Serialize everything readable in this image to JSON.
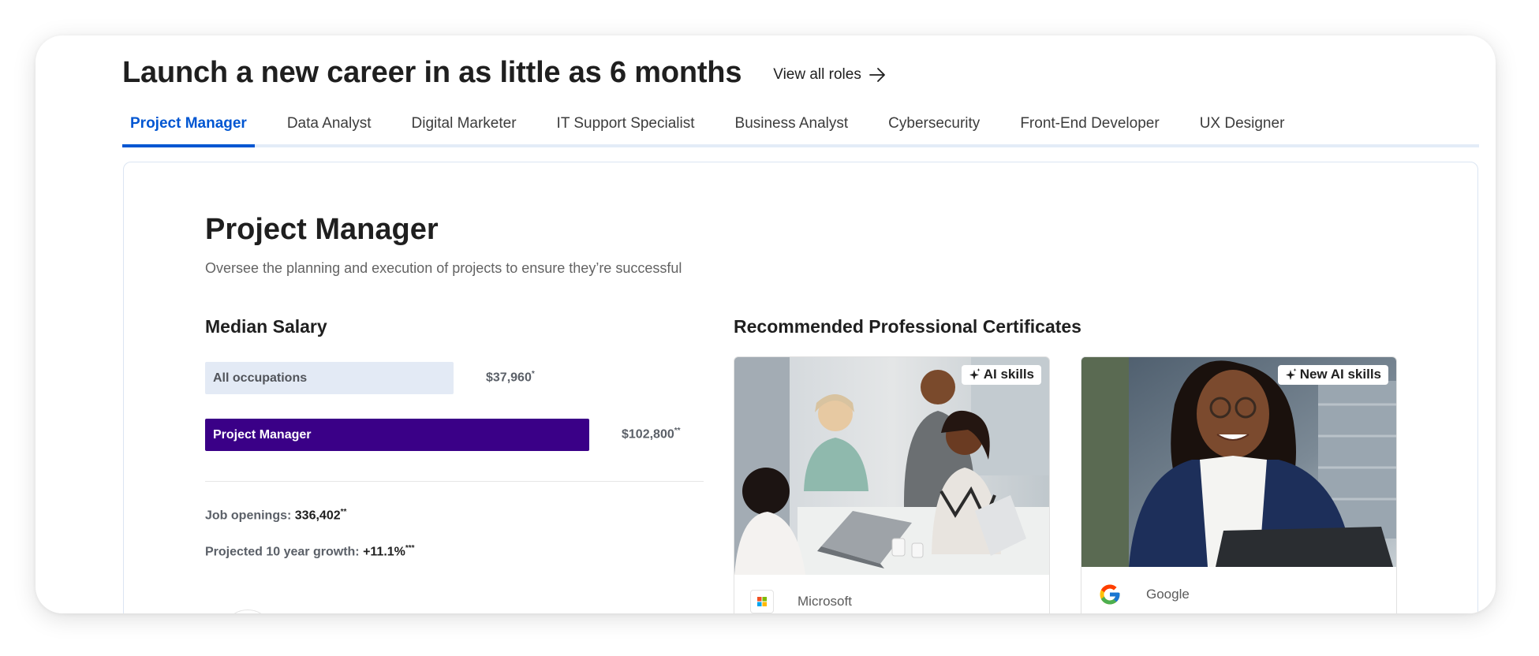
{
  "header": {
    "headline": "Launch a new career in as little as 6 months",
    "view_all_label": "View all roles"
  },
  "tabs": [
    {
      "label": "Project Manager",
      "active": true
    },
    {
      "label": "Data Analyst",
      "active": false
    },
    {
      "label": "Digital Marketer",
      "active": false
    },
    {
      "label": "IT Support Specialist",
      "active": false
    },
    {
      "label": "Business Analyst",
      "active": false
    },
    {
      "label": "Cybersecurity",
      "active": false
    },
    {
      "label": "Front-End Developer",
      "active": false
    },
    {
      "label": "UX Designer",
      "active": false
    }
  ],
  "role": {
    "title": "Project Manager",
    "description": "Oversee the planning and execution of projects to ensure they’re successful"
  },
  "salary": {
    "title": "Median Salary",
    "rows": [
      {
        "label": "All occupations",
        "value": "$37,960",
        "mark": "*",
        "amount": 37960
      },
      {
        "label": "Project Manager",
        "value": "$102,800",
        "mark": "**",
        "amount": 102800
      }
    ]
  },
  "stats": {
    "jobs_label": "Job openings: ",
    "jobs_value": "336,402",
    "jobs_mark": "**",
    "growth_label": "Projected 10 year growth: ",
    "growth_value": "+11.1%",
    "growth_mark": "***"
  },
  "certificates": {
    "title": "Recommended Professional Certificates",
    "cards": [
      {
        "badge": "AI skills",
        "partner": "Microsoft",
        "logo": "microsoft-logo",
        "image": "office-meeting-photo"
      },
      {
        "badge": "New AI skills",
        "partner": "Google",
        "logo": "google-logo",
        "image": "smiling-professional-photo"
      }
    ]
  },
  "colors": {
    "accent_blue": "#0056d2",
    "pm_bar": "#3a0087",
    "all_bar": "#e3eaf5",
    "tab_rule": "#e3ecf7"
  }
}
